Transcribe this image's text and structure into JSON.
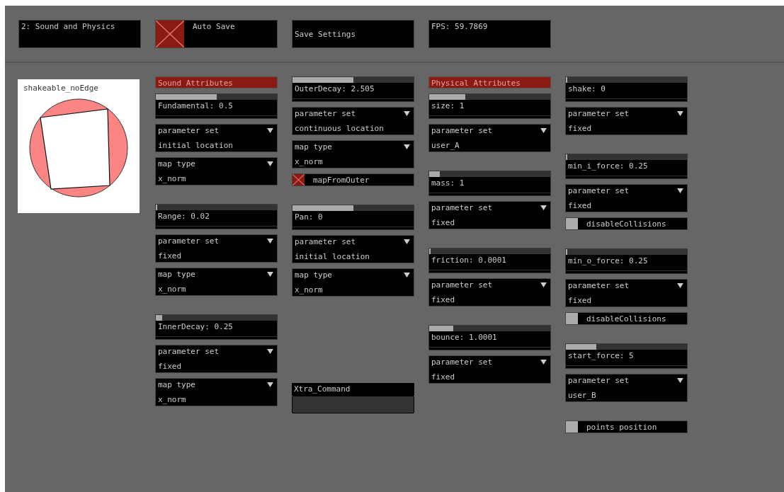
{
  "top_bar": [
    {
      "kind": "label",
      "text": "2: Sound and Physics"
    },
    {
      "kind": "toggle",
      "text": "Auto Save",
      "checked": true
    },
    {
      "kind": "button",
      "text": "Save Settings"
    },
    {
      "kind": "label",
      "text": "FPS: 59.7869"
    }
  ],
  "preview": {
    "title": "shakeable_noEdge"
  },
  "columns": [
    {
      "groups": [
        {
          "items": [
            {
              "kind": "header",
              "text": "Sound Attributes"
            },
            {
              "kind": "slider",
              "label": "Fundamental: 0.5",
              "level": 0.5
            },
            {
              "kind": "dropdown",
              "label": "parameter set",
              "value": "initial location"
            },
            {
              "kind": "dropdown",
              "label": "map type",
              "value": "x_norm"
            }
          ]
        },
        {
          "items": [
            {
              "kind": "slider",
              "label": "Range: 0.02",
              "level": 0.01
            },
            {
              "kind": "dropdown",
              "label": "parameter set",
              "value": "fixed"
            },
            {
              "kind": "dropdown",
              "label": "map type",
              "value": "x_norm"
            }
          ]
        },
        {
          "items": [
            {
              "kind": "slider",
              "label": "InnerDecay: 0.25",
              "level": 0.05
            },
            {
              "kind": "dropdown",
              "label": "parameter set",
              "value": "fixed"
            },
            {
              "kind": "dropdown",
              "label": "map type",
              "value": "x_norm"
            }
          ]
        }
      ]
    },
    {
      "groups": [
        {
          "items": [
            {
              "kind": "slider",
              "label": "OuterDecay: 2.505",
              "level": 0.5
            },
            {
              "kind": "dropdown",
              "label": "parameter set",
              "value": "continuous location"
            },
            {
              "kind": "dropdown",
              "label": "map type",
              "value": "x_norm"
            },
            {
              "kind": "checkbox",
              "label": "mapFromOuter",
              "checked": true
            }
          ]
        },
        {
          "items": [
            {
              "kind": "slider",
              "label": "Pan: 0",
              "level": 0.5
            },
            {
              "kind": "dropdown",
              "label": "parameter set",
              "value": "initial location"
            },
            {
              "kind": "dropdown",
              "label": "map type",
              "value": "x_norm"
            }
          ]
        },
        {
          "items": [
            {
              "kind": "text_input",
              "label": "Xtra_Command"
            }
          ]
        }
      ]
    },
    {
      "groups": [
        {
          "items": [
            {
              "kind": "header",
              "text": "Physical Attributes"
            },
            {
              "kind": "slider",
              "label": "size: 1",
              "level": 0.3
            },
            {
              "kind": "dropdown",
              "label": "parameter set",
              "value": "user_A"
            }
          ]
        },
        {
          "items": [
            {
              "kind": "slider",
              "label": "mass: 1",
              "level": 0.09
            },
            {
              "kind": "dropdown",
              "label": "parameter set",
              "value": "fixed"
            }
          ]
        },
        {
          "items": [
            {
              "kind": "slider",
              "label": "friction: 0.0001",
              "level": 0
            },
            {
              "kind": "dropdown",
              "label": "parameter set",
              "value": "fixed"
            }
          ]
        },
        {
          "items": [
            {
              "kind": "slider",
              "label": "bounce: 1.0001",
              "level": 0.2
            },
            {
              "kind": "dropdown",
              "label": "parameter set",
              "value": "fixed"
            }
          ]
        }
      ]
    },
    {
      "groups": [
        {
          "items": [
            {
              "kind": "slider",
              "label": "shake: 0",
              "level": 0
            },
            {
              "kind": "dropdown",
              "label": "parameter set",
              "value": "fixed"
            }
          ]
        },
        {
          "items": [
            {
              "kind": "slider",
              "label": "min_i_force: 0.25",
              "level": 0.01
            },
            {
              "kind": "dropdown",
              "label": "parameter set",
              "value": "fixed"
            },
            {
              "kind": "checkbox",
              "label": "disableCollisions",
              "checked": false
            }
          ]
        },
        {
          "items": [
            {
              "kind": "slider",
              "label": "min_o_force: 0.25",
              "level": 0.01
            },
            {
              "kind": "dropdown",
              "label": "parameter set",
              "value": "fixed"
            },
            {
              "kind": "checkbox",
              "label": "disableCollisions",
              "checked": false
            }
          ]
        },
        {
          "items": [
            {
              "kind": "slider",
              "label": "start_force: 5",
              "level": 0.25
            },
            {
              "kind": "dropdown",
              "label": "parameter set",
              "value": "user_B"
            }
          ]
        },
        {
          "items": [
            {
              "kind": "checkbox",
              "label": "points position",
              "checked": false
            }
          ]
        }
      ]
    }
  ]
}
